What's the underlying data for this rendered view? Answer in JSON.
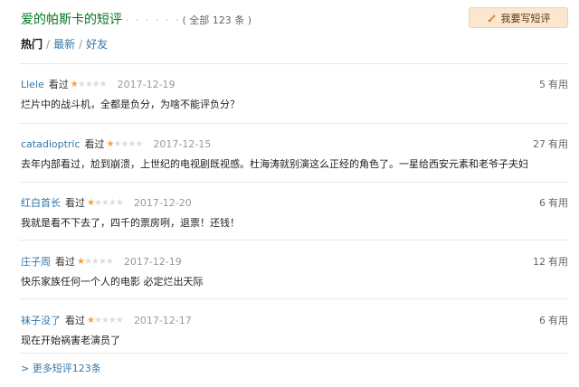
{
  "header": {
    "title": "爱的帕斯卡的短评",
    "dots": "· · · · · ·",
    "count": "( 全部 123 条 )",
    "write_label": "我要写短评"
  },
  "tabs": [
    {
      "label": "热门"
    },
    {
      "label": "最新"
    },
    {
      "label": "好友"
    }
  ],
  "tab_separator": "/",
  "status_label": "看过",
  "useful_label": "有用",
  "rating_stars": 1,
  "comments": [
    {
      "user": "Llele",
      "date": "2017-12-19",
      "votes": "5",
      "text": "烂片中的战斗机，全都是负分，为啥不能评负分？"
    },
    {
      "user": "catadioptric",
      "date": "2017-12-15",
      "votes": "27",
      "text": "去年内部看过，尬到崩溃，上世纪的电视剧既视感。杜海涛就别演这么正经的角色了。一星给西安元素和老爷子夫妇"
    },
    {
      "user": "红白首长",
      "date": "2017-12-20",
      "votes": "6",
      "text": "我就是看不下去了，四千的票房咧，退票！还钱！"
    },
    {
      "user": "庄子周",
      "date": "2017-12-19",
      "votes": "12",
      "text": "快乐家族任何一个人的电影 必定烂出天际"
    },
    {
      "user": "袜子没了",
      "date": "2017-12-17",
      "votes": "6",
      "text": "现在开始祸害老演员了"
    }
  ],
  "more_label": "> 更多短评123条",
  "colors": {
    "title": "#007722",
    "link": "#3377aa",
    "star": "#f8a03a",
    "button_bg": "#fbe6cf"
  }
}
